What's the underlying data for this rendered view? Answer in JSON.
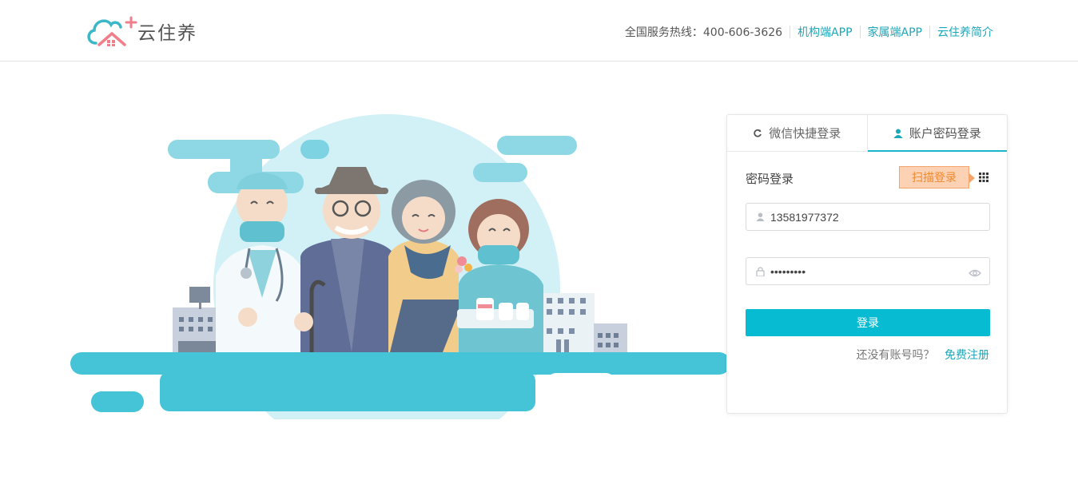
{
  "header": {
    "logo_text": "云住养",
    "hotline": "全国服务热线：400-606-3626",
    "links": [
      "机构端APP",
      "家属端APP",
      "云住养简介"
    ]
  },
  "login": {
    "tabs": [
      {
        "label": "微信快捷登录",
        "icon": "wechat-icon",
        "active": false
      },
      {
        "label": "账户密码登录",
        "icon": "user-icon",
        "active": true
      }
    ],
    "title": "密码登录",
    "qr_tip": "扫描登录",
    "username": {
      "value": "13581977372",
      "icon": "user-icon"
    },
    "password": {
      "value": "•••••••••",
      "icon": "lock-icon"
    },
    "submit_label": "登录",
    "register_prompt": "还没有账号吗？",
    "register_link": "免费注册"
  },
  "colors": {
    "accent": "#07bbd3",
    "link": "#1aa7b9",
    "qr_tip_bg": "#fcd1b4",
    "qr_tip_text": "#f08a2c"
  }
}
